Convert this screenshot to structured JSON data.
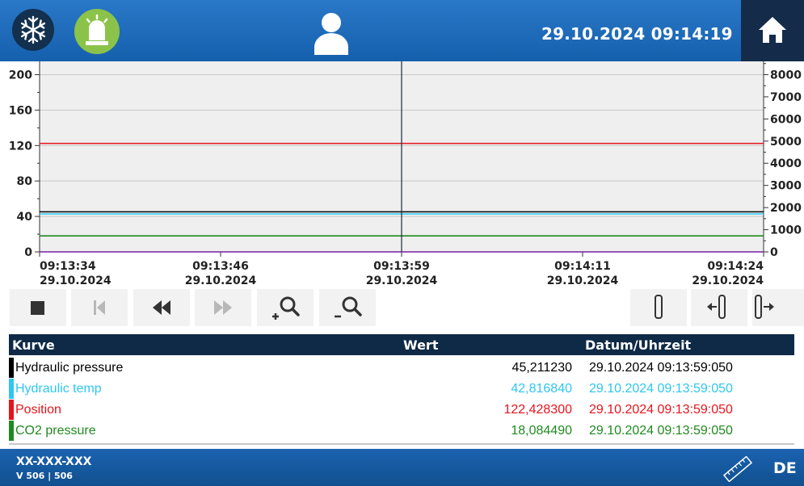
{
  "header": {
    "datetime": "29.10.2024 09:14:19",
    "icons": [
      "snowflake-icon",
      "alarm-beacon-icon",
      "user-icon",
      "home-icon"
    ]
  },
  "chart_data": {
    "type": "line",
    "y_left": {
      "ticks": [
        "0",
        "40",
        "80",
        "120",
        "160",
        "200"
      ],
      "range": [
        0,
        215
      ]
    },
    "y_right": {
      "ticks": [
        "0",
        "1000",
        "2000",
        "3000",
        "4000",
        "5000",
        "6000",
        "7000",
        "8000"
      ],
      "range": [
        0,
        8600
      ]
    },
    "x_ticks": [
      {
        "time": "09:13:34",
        "date": "29.10.2024"
      },
      {
        "time": "09:13:46",
        "date": "29.10.2024"
      },
      {
        "time": "09:13:59",
        "date": "29.10.2024"
      },
      {
        "time": "09:14:11",
        "date": "29.10.2024"
      },
      {
        "time": "09:14:24",
        "date": "29.10.2024"
      }
    ],
    "cursor_time": "09:13:59",
    "grid": true,
    "series": [
      {
        "name": "Hydraulic pressure",
        "color": "#000000",
        "value": 45.21123
      },
      {
        "name": "Hydraulic temp",
        "color": "#2ec7f0",
        "value": 42.81684
      },
      {
        "name": "Position",
        "color": "#e8141c",
        "value": 122.4283
      },
      {
        "name": "CO2 pressure",
        "color": "#1f8a1f",
        "value": 18.08449
      },
      {
        "name": "",
        "color": "#7a1fa2",
        "value": 0
      }
    ]
  },
  "toolbar": {
    "buttons": [
      "stop-icon",
      "skip-start-icon",
      "rewind-icon",
      "fast-forward-icon",
      "zoom-in-icon",
      "zoom-out-icon",
      "cursor-icon",
      "cursor-left-icon",
      "cursor-right-icon"
    ]
  },
  "table": {
    "headers": {
      "curve": "Kurve",
      "value": "Wert",
      "datetime": "Datum/Uhrzeit"
    },
    "rows": [
      {
        "name": "Hydraulic pressure",
        "value": "45,211230",
        "datetime": "29.10.2024 09:13:59:050",
        "color": "#000000"
      },
      {
        "name": "Hydraulic temp",
        "value": "42,816840",
        "datetime": "29.10.2024 09:13:59:050",
        "color": "#2ec7f0"
      },
      {
        "name": "Position",
        "value": "122,428300",
        "datetime": "29.10.2024 09:13:59:050",
        "color": "#e8141c"
      },
      {
        "name": "CO2 pressure",
        "value": "18,084490",
        "datetime": "29.10.2024 09:13:59:050",
        "color": "#1f8a1f"
      }
    ]
  },
  "footer": {
    "device": "XX-XXX-XXX",
    "version": "V 506 | 506",
    "language": "DE"
  }
}
